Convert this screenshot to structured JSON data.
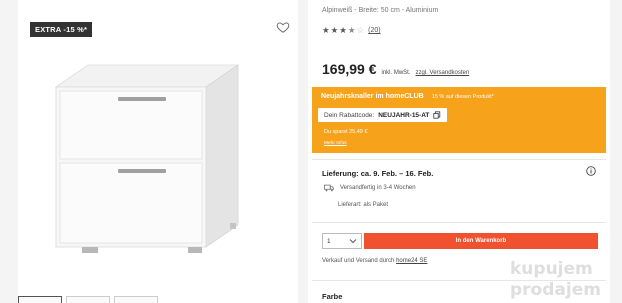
{
  "product": {
    "badge": "EXTRA -15 %*",
    "subtitle": "Alpinweiß - Breite: 50 cm - Aluminium",
    "rating": {
      "stars": 3.5,
      "max": 5,
      "count_text": "(20)"
    },
    "price": "169,99 €",
    "price_note": "inkl. MwSt.",
    "shipping_link": "zzgl. Versandkosten"
  },
  "promo": {
    "title": "Neujahrsknaller im homeCLUB",
    "subtitle": "15 % auf diesen Produkt*",
    "coupon_label": "Dein Rabattcode:",
    "coupon_code": "NEUJAHR-15-AT",
    "savings": "Du sparst 25,49 €",
    "more_link": "Mehr Infos",
    "bg_color": "#f7a21b"
  },
  "delivery": {
    "title": "Lieferung: ca. 9. Feb. – 16. Feb.",
    "shipping": "Versandfertig in 3-4 Wochen",
    "type": "Lieferart: als Paket"
  },
  "cart": {
    "qty": "1",
    "button_label": "In den Warenkorb",
    "button_color": "#f0522f"
  },
  "seller": {
    "text": "Verkauf und Versand durch",
    "link": "home24 SE"
  },
  "section": {
    "farbe": "Farbe"
  },
  "watermark": {
    "line1": "kupujem",
    "line2": "prodajem"
  },
  "icons": [
    "heart-icon",
    "star-icon",
    "copy-icon",
    "info-icon",
    "truck-icon",
    "chevron-down-icon"
  ]
}
